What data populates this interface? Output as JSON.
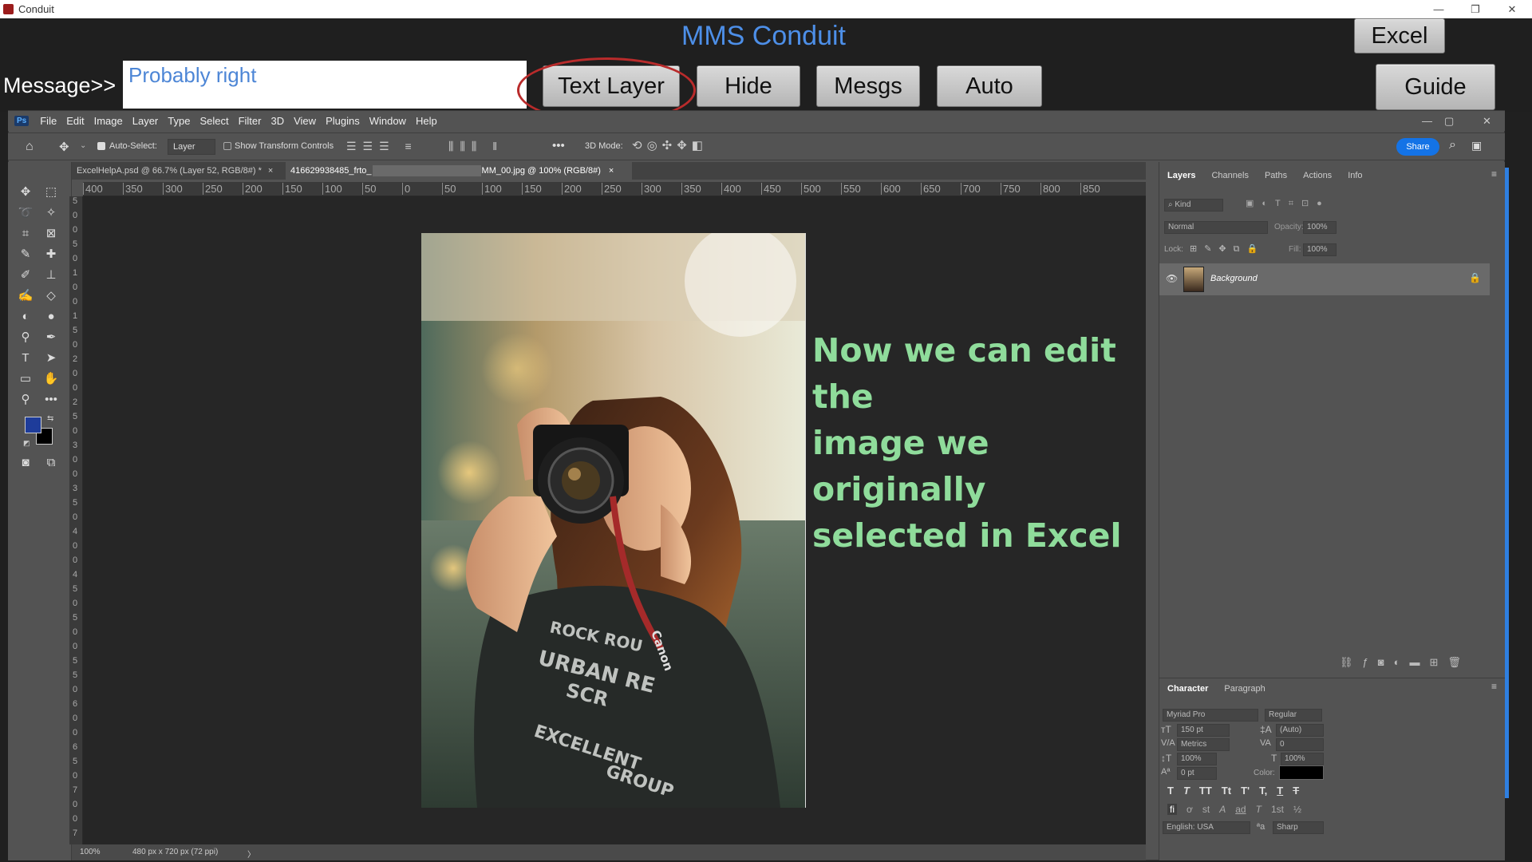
{
  "window": {
    "title": "Conduit"
  },
  "conduit": {
    "title": "MMS Conduit",
    "message_label": "Message>>",
    "message_value": "Probably right",
    "buttons": {
      "excel": "Excel",
      "text_layer": "Text Layer",
      "hide": "Hide",
      "mesgs": "Mesgs",
      "auto": "Auto",
      "guide": "Guide"
    }
  },
  "photoshop": {
    "logo": "Ps",
    "menu": [
      "File",
      "Edit",
      "Image",
      "Layer",
      "Type",
      "Select",
      "Filter",
      "3D",
      "View",
      "Plugins",
      "Window",
      "Help"
    ],
    "options": {
      "auto_select": "Auto-Select:",
      "layer_dropdown": "Layer",
      "show_transform": "Show Transform Controls",
      "three_d_mode": "3D Mode:",
      "share": "Share"
    },
    "doc_tabs": [
      {
        "label": "ExcelHelpA.psd @ 66.7% (Layer 52, RGB/8#) *",
        "close": "×"
      },
      {
        "label": "416629938485_frto_",
        "label_end": "MM_00.jpg @ 100% (RGB/8#)",
        "close": "×"
      }
    ],
    "ruler_h": [
      "400",
      "350",
      "300",
      "250",
      "200",
      "150",
      "100",
      "50",
      "0",
      "50",
      "100",
      "150",
      "200",
      "250",
      "300",
      "350",
      "400",
      "450",
      "500",
      "550",
      "600",
      "650",
      "700",
      "750",
      "800",
      "850"
    ],
    "ruler_v": [
      "5",
      "0",
      "0",
      "5",
      "0",
      "1",
      "0",
      "0",
      "1",
      "5",
      "0",
      "2",
      "0",
      "0",
      "2",
      "5",
      "0",
      "3",
      "0",
      "0",
      "3",
      "5",
      "0",
      "4",
      "0",
      "0",
      "4",
      "5",
      "0",
      "5",
      "0",
      "0",
      "5",
      "5",
      "0",
      "6",
      "0",
      "0",
      "6",
      "5",
      "0",
      "7",
      "0",
      "0",
      "7"
    ],
    "overlay_text": [
      "Now we can edit the",
      "image we originally",
      "selected in Excel"
    ],
    "photo_shirt_text": [
      "ROCK ROU",
      "URBAN RE",
      "SCR",
      "EXCELLENT",
      "GROUP"
    ],
    "camera_strap_text": "Canon",
    "status": {
      "zoom": "100%",
      "doc_info": "480 px x 720 px (72 ppi)",
      "arrow": "〉"
    },
    "layers_panel": {
      "tabs": [
        "Layers",
        "Channels",
        "Paths",
        "Actions",
        "Info"
      ],
      "filter_placeholder": "Kind",
      "blend_mode": "Normal",
      "opacity_label": "Opacity:",
      "opacity_value": "100%",
      "lock_label": "Lock:",
      "fill_label": "Fill:",
      "fill_value": "100%",
      "layers": [
        {
          "name": "Background",
          "visible": true,
          "locked": true
        }
      ]
    },
    "character_panel": {
      "tabs": [
        "Character",
        "Paragraph"
      ],
      "font_family": "Myriad Pro",
      "font_style": "Regular",
      "font_size": "150 pt",
      "leading": "(Auto)",
      "kerning": "Metrics",
      "tracking": "0",
      "vertical_scale": "100%",
      "horizontal_scale": "100%",
      "baseline_shift": "0 pt",
      "color_label": "Color:",
      "color_value": "#000000",
      "language": "English: USA",
      "aa_label": "ªa",
      "antialias": "Sharp",
      "type_buttons": [
        "T",
        "T",
        "TT",
        "Tt",
        "T'",
        "T,",
        "T",
        "T"
      ],
      "opentype_buttons": [
        "fi",
        "ơ",
        "st",
        "A",
        "ad",
        "T",
        "1st",
        "½"
      ]
    }
  },
  "colors": {
    "accent_blue": "#4d8fe8",
    "overlay_green": "#8fdc9b",
    "ring_red": "#b92b2b",
    "fg_swatch": "#1e3c9a",
    "bg_swatch": "#000000"
  }
}
